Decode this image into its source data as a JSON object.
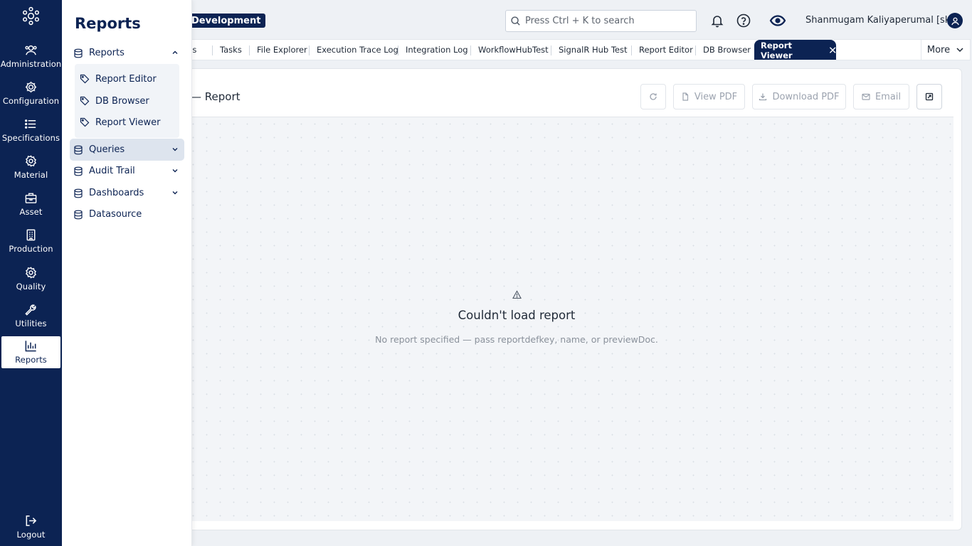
{
  "header": {
    "environment": "Development",
    "search_placeholder": "Press Ctrl + K to search",
    "user_name": "Shanmugam Kaliyaperumal [sk]"
  },
  "rail": {
    "items": [
      {
        "label": "Administration",
        "icon": "users-icon"
      },
      {
        "label": "Configuration",
        "icon": "gear-icon"
      },
      {
        "label": "Specifications",
        "icon": "list-icon"
      },
      {
        "label": "Material",
        "icon": "cog-icon"
      },
      {
        "label": "Asset",
        "icon": "toolbox-icon"
      },
      {
        "label": "Production",
        "icon": "building-icon"
      },
      {
        "label": "Quality",
        "icon": "gear-check-icon"
      },
      {
        "label": "Utilities",
        "icon": "wrench-icon"
      },
      {
        "label": "Reports",
        "icon": "bar-chart-icon"
      }
    ],
    "active": "Reports",
    "logout_label": "Logout"
  },
  "flyout": {
    "title": "Reports",
    "group_reports": "Reports",
    "sub_items": [
      "Report Editor",
      "DB Browser",
      "Report Viewer"
    ],
    "queries": "Queries",
    "audit_trail": "Audit Trail",
    "dashboards": "Dashboards",
    "datasource": "Datasource"
  },
  "tabs": {
    "items": [
      "ons",
      "Tasks",
      "File Explorer",
      "Execution Trace Log",
      "Integration Log",
      "WorkflowHubTest",
      "SignalR Hub Test",
      "Report Editor",
      "DB Browser"
    ],
    "active": "Report Viewer",
    "more": "More"
  },
  "card": {
    "title": "— Report",
    "view_pdf": "View PDF",
    "download_pdf": "Download PDF",
    "email": "Email"
  },
  "error": {
    "title": "Couldn't load report",
    "message": "No report specified — pass reportdefkey, name, or previewDoc."
  }
}
